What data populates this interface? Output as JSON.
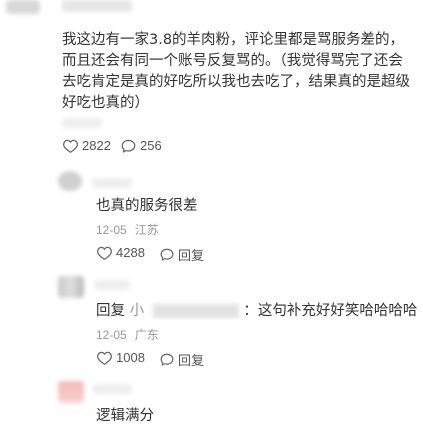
{
  "main_comment": {
    "text": "我这边有一家3.8的羊肉粉，评论里都是骂服务差的，而且还会有同一个账号反复骂的。（我觉得骂完了还会去吃肯定是真的好吃所以我也去吃了，结果真的是超级好吃也真的）",
    "likes": "2822",
    "comments": "256"
  },
  "replies": [
    {
      "text": "也真的服务很差",
      "date": "12-05",
      "location": "江苏",
      "likes": "4288",
      "reply_label": "回复"
    },
    {
      "reply_prefix": "回复",
      "reply_target_initial": "小",
      "text": "：这句补充好好笑哈哈哈哈",
      "date": "12-05",
      "location": "广东",
      "likes": "1008",
      "reply_label": "回复"
    },
    {
      "text": "逻辑满分"
    }
  ],
  "colors": {
    "text": "#333333",
    "meta": "#999999",
    "icon": "#666666"
  }
}
